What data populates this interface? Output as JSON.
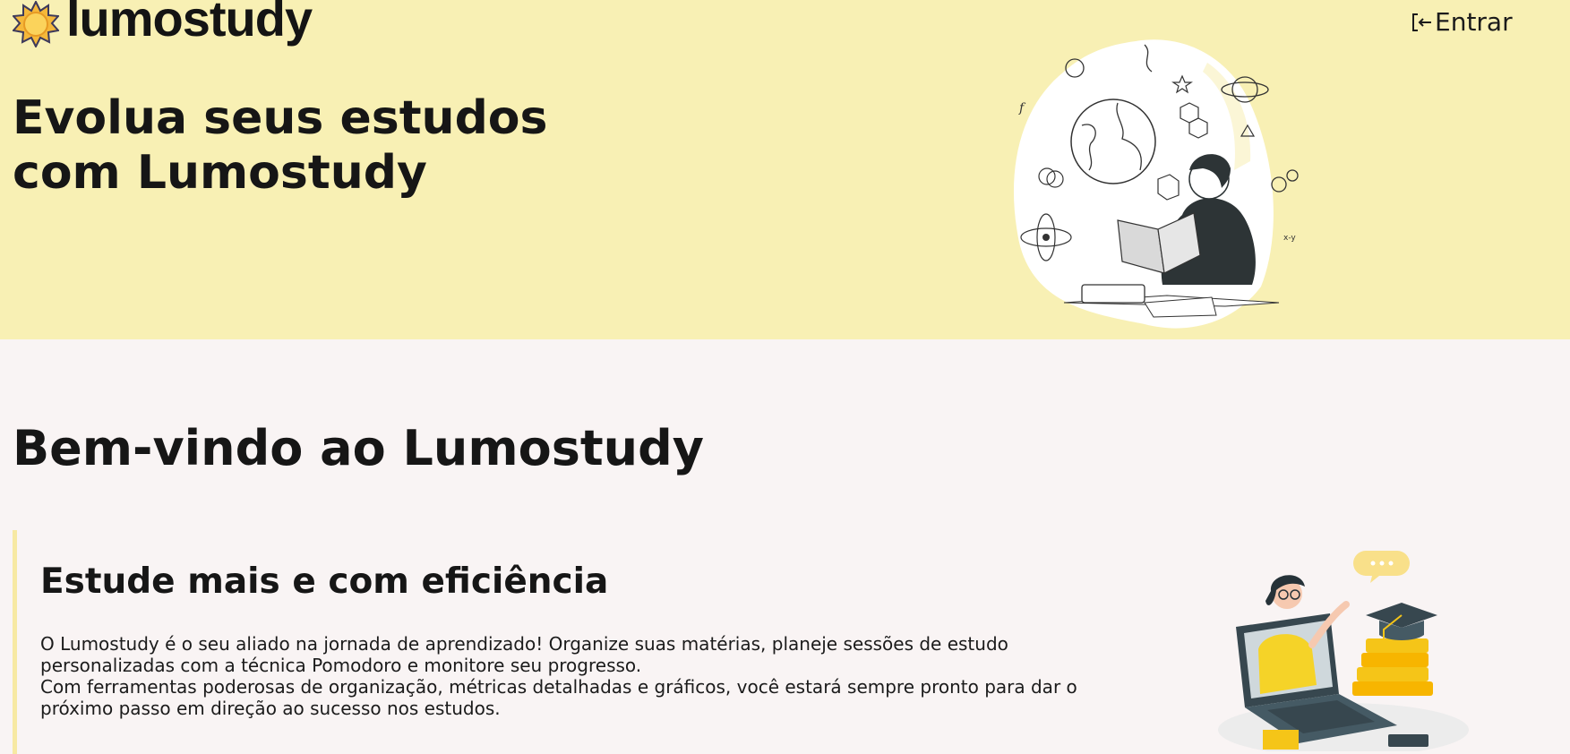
{
  "header": {
    "logo_text": "lumostudy",
    "login_label": "Entrar",
    "icons": {
      "logo": "sun-icon",
      "login": "login-arrow-icon"
    }
  },
  "hero": {
    "title": "Evolua seus estudos com Lumostudy",
    "illustration": "student-reading-science-illustration"
  },
  "welcome": {
    "title": "Bem-vindo ao Lumostudy"
  },
  "feature": {
    "title": "Estude mais e com eficiência",
    "paragraph_1": "O Lumostudy é o seu aliado na jornada de aprendizado! Organize suas matérias, planeje sessões de estudo personalizadas com a técnica Pomodoro e monitore seu progresso.",
    "paragraph_2": "Com ferramentas poderosas de organização, métricas detalhadas e gráficos, você estará sempre pronto para dar o próximo passo em direção ao sucesso nos estudos.",
    "illustration": "online-class-graduation-illustration"
  },
  "colors": {
    "hero_background": "#f8f0b4",
    "page_background": "#f9f4f4",
    "accent_yellow": "#f5c518",
    "text_dark": "#161616"
  }
}
